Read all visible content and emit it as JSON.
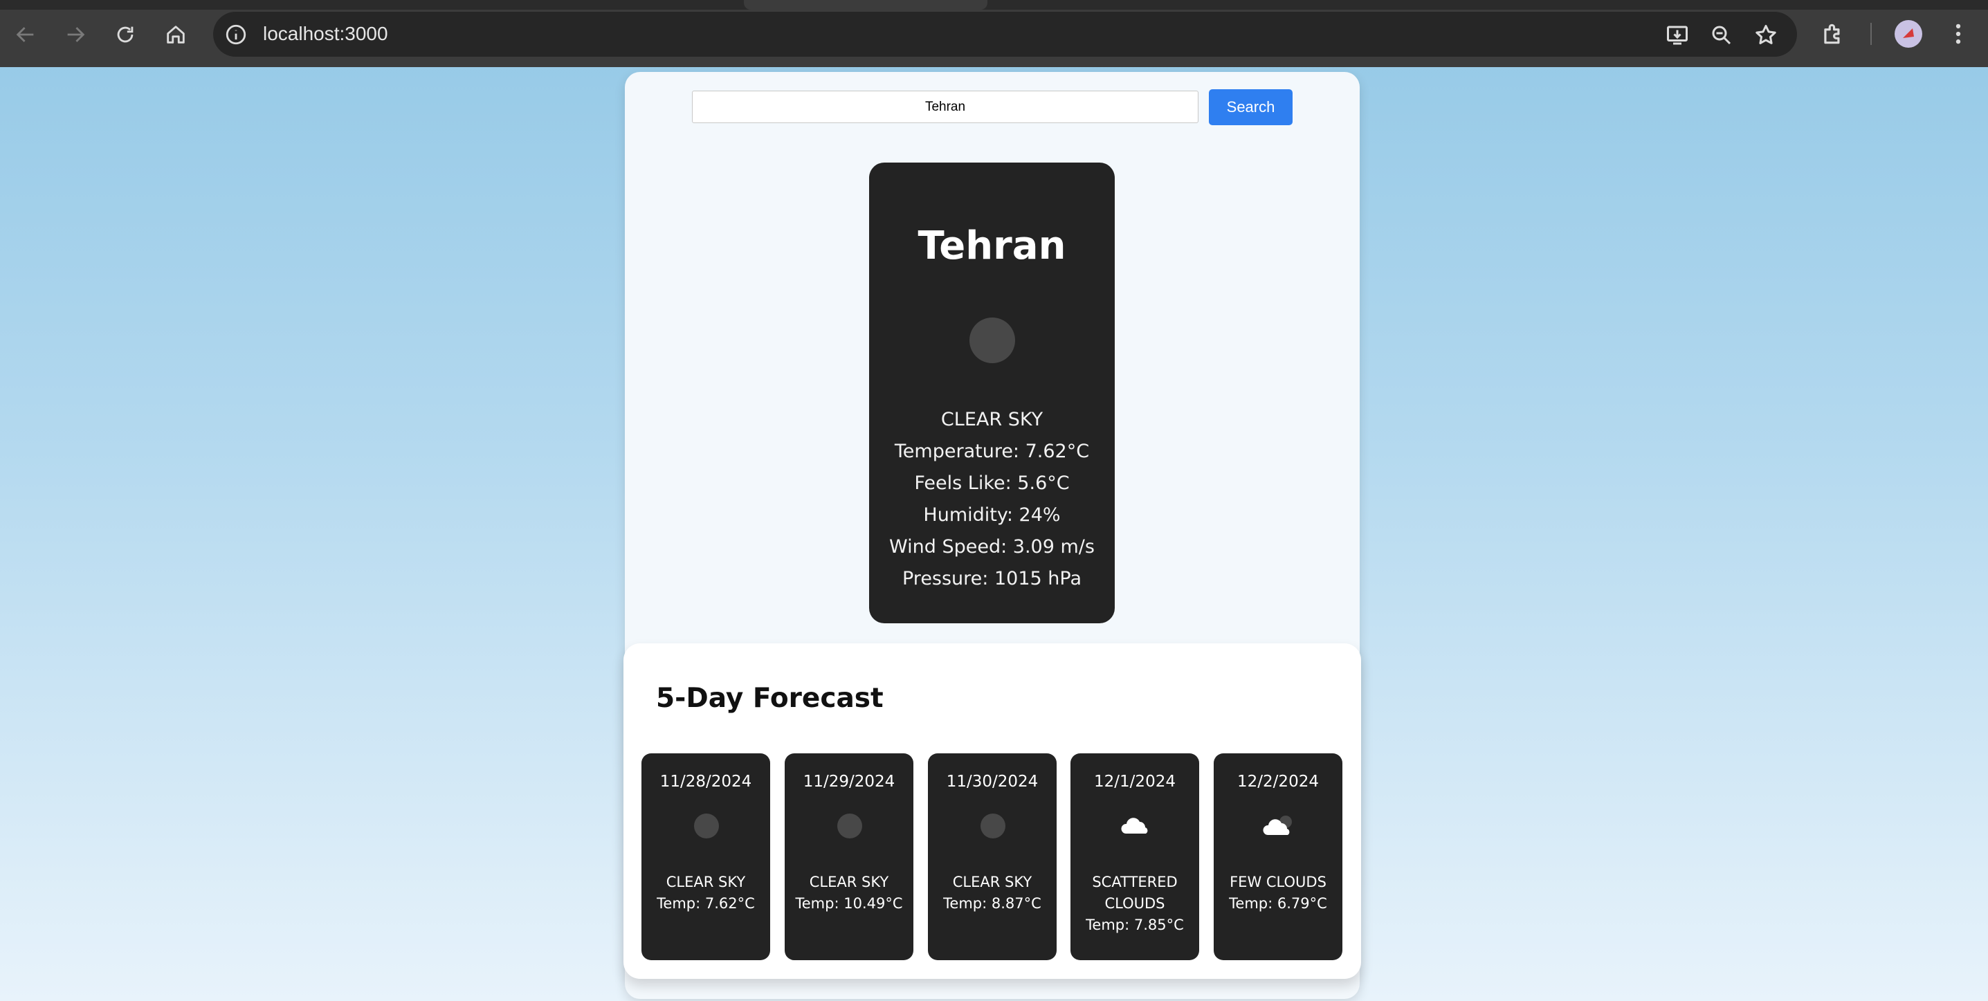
{
  "browser": {
    "url": "localhost:3000"
  },
  "search": {
    "value": "Tehran",
    "button_label": "Search"
  },
  "current": {
    "city": "Tehran",
    "icon": "clear-sky-icon",
    "description": "CLEAR SKY",
    "temperature": "Temperature: 7.62°C",
    "feels_like": "Feels Like: 5.6°C",
    "humidity": "Humidity: 24%",
    "wind_speed": "Wind Speed: 3.09 m/s",
    "pressure": "Pressure: 1015 hPa"
  },
  "forecast": {
    "title": "5-Day Forecast",
    "days": [
      {
        "date": "11/28/2024",
        "icon": "clear-sky-icon",
        "description": "CLEAR SKY",
        "temp": "Temp: 7.62°C"
      },
      {
        "date": "11/29/2024",
        "icon": "clear-sky-icon",
        "description": "CLEAR SKY",
        "temp": "Temp: 10.49°C"
      },
      {
        "date": "11/30/2024",
        "icon": "clear-sky-icon",
        "description": "CLEAR SKY",
        "temp": "Temp: 8.87°C"
      },
      {
        "date": "12/1/2024",
        "icon": "scattered-clouds-icon",
        "description": "SCATTERED CLOUDS",
        "temp": "Temp: 7.85°C"
      },
      {
        "date": "12/2/2024",
        "icon": "few-clouds-icon",
        "description": "FEW CLOUDS",
        "temp": "Temp: 6.79°C"
      }
    ]
  },
  "colors": {
    "accent": "#2f7ff0",
    "card_dark": "#232323"
  }
}
